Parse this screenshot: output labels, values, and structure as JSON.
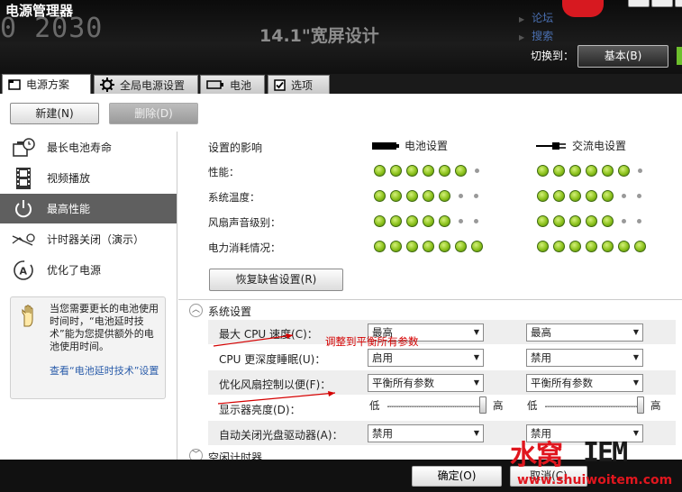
{
  "header": {
    "title": "电源管理器",
    "ghost_text": "0 2030",
    "screen_text": "14.1\"宽屏设计",
    "links": [
      "论坛",
      "搜索"
    ],
    "switch_label": "切换到：",
    "switch_button": "基本(B)"
  },
  "tabs": [
    {
      "label": "电源方案",
      "icon": "page-icon"
    },
    {
      "label": "全局电源设置",
      "icon": "gear-icon"
    },
    {
      "label": "电池",
      "icon": "battery-icon"
    },
    {
      "label": "选项",
      "icon": "checkbox-icon"
    }
  ],
  "toolbar": {
    "new_label": "新建(N)",
    "delete_label": "删除(D)"
  },
  "sidebar": {
    "items": [
      {
        "label": "最长电池寿命",
        "icon": "battery-clock-icon"
      },
      {
        "label": "视频播放",
        "icon": "film-icon"
      },
      {
        "label": "最高性能",
        "icon": "power-icon"
      },
      {
        "label": "计时器关闭（演示）",
        "icon": "timer-off-icon"
      },
      {
        "label": "优化了电源",
        "icon": "auto-icon"
      }
    ],
    "tip_text": "当您需要更长的电池使用时间时，“电池延时技术”能为您提供额外的电池使用时间。",
    "tip_link": "查看“电池延时技术”设置"
  },
  "impact": {
    "header": "设置的影响",
    "battery_col": "电池设置",
    "ac_col": "交流电设置",
    "rows": [
      {
        "label": "性能：",
        "battery": 6,
        "ac": 6
      },
      {
        "label": "系统温度：",
        "battery": 5,
        "ac": 5
      },
      {
        "label": "风扇声音级别：",
        "battery": 5,
        "ac": 5
      },
      {
        "label": "电力消耗情况：",
        "battery": 7,
        "ac": 7
      }
    ],
    "total_dots": 7,
    "restore_label": "恢复缺省设置(R)"
  },
  "system_settings": {
    "title": "系统设置",
    "rows": [
      {
        "label": "最大 CPU 速度(C)：",
        "battery": "最高",
        "ac": "最高"
      },
      {
        "label": "CPU 更深度睡眠(U)：",
        "battery": "启用",
        "ac": "禁用"
      },
      {
        "label": "优化风扇控制以便(F)：",
        "battery": "平衡所有参数",
        "ac": "平衡所有参数"
      },
      {
        "label": "显示器亮度(D)：",
        "low": "低",
        "high": "高",
        "battery_level": 1.0,
        "ac_level": 1.0
      },
      {
        "label": "自动关闭光盘驱动器(A)：",
        "battery": "禁用",
        "ac": "禁用"
      }
    ],
    "annotation": "调整到平衡所有参数",
    "next_section": "空闲计时器"
  },
  "footer": {
    "ok_label": "确定(O)",
    "cancel_label": "取消(C)"
  },
  "watermark": {
    "part1": "水窝",
    "part2": "IEM",
    "url": "www.shuiwoitem.com"
  }
}
